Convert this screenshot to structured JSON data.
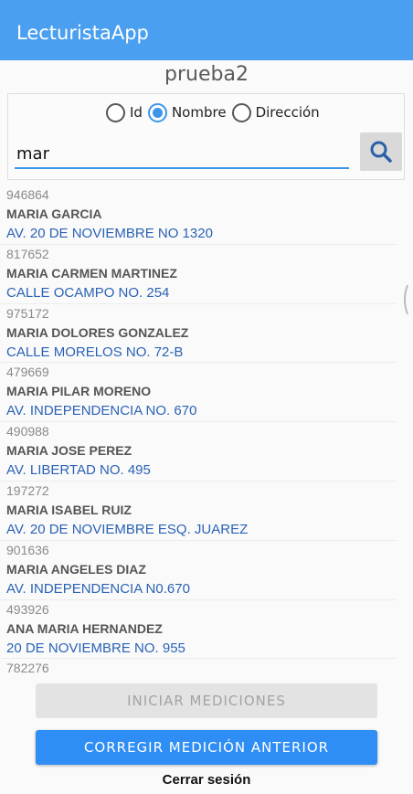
{
  "app": {
    "title": "LecturistaApp"
  },
  "subtitle": "prueba2",
  "filter": {
    "options": [
      {
        "label": "Id",
        "checked": false
      },
      {
        "label": "Nombre",
        "checked": true
      },
      {
        "label": "Dirección",
        "checked": false
      }
    ]
  },
  "search": {
    "value": "mar",
    "icon": "search-icon"
  },
  "results": [
    {
      "id": "946864",
      "name": "MARIA GARCIA",
      "address": "AV. 20 DE NOVIEMBRE NO 1320"
    },
    {
      "id": "817652",
      "name": "MARIA CARMEN MARTINEZ",
      "address": "CALLE OCAMPO NO. 254"
    },
    {
      "id": "975172",
      "name": "MARIA DOLORES GONZALEZ",
      "address": "CALLE MORELOS NO. 72-B"
    },
    {
      "id": "479669",
      "name": "MARIA PILAR MORENO",
      "address": "AV. INDEPENDENCIA NO. 670"
    },
    {
      "id": "490988",
      "name": "MARIA JOSE PEREZ",
      "address": "AV. LIBERTAD NO. 495"
    },
    {
      "id": "197272",
      "name": "MARIA ISABEL RUIZ",
      "address": "AV. 20 DE NOVIEMBRE ESQ. JUAREZ"
    },
    {
      "id": "901636",
      "name": "MARIA ANGELES DIAZ",
      "address": "AV. INDEPENDENCIA N0.670"
    },
    {
      "id": "493926",
      "name": "ANA MARIA HERNANDEZ",
      "address": "20 DE NOVIEMBRE NO. 955"
    },
    {
      "id": "782276",
      "name": "",
      "address": ""
    }
  ],
  "buttons": {
    "start": "INICIAR MEDICIONES",
    "correct": "CORREGIR MEDICIÓN ANTERIOR",
    "logout": "Cerrar sesión"
  },
  "colors": {
    "appbar": "#4a9ff0",
    "accent": "#3b95e8",
    "primary_button": "#2f8ef5",
    "address_text": "#2a62b5"
  }
}
